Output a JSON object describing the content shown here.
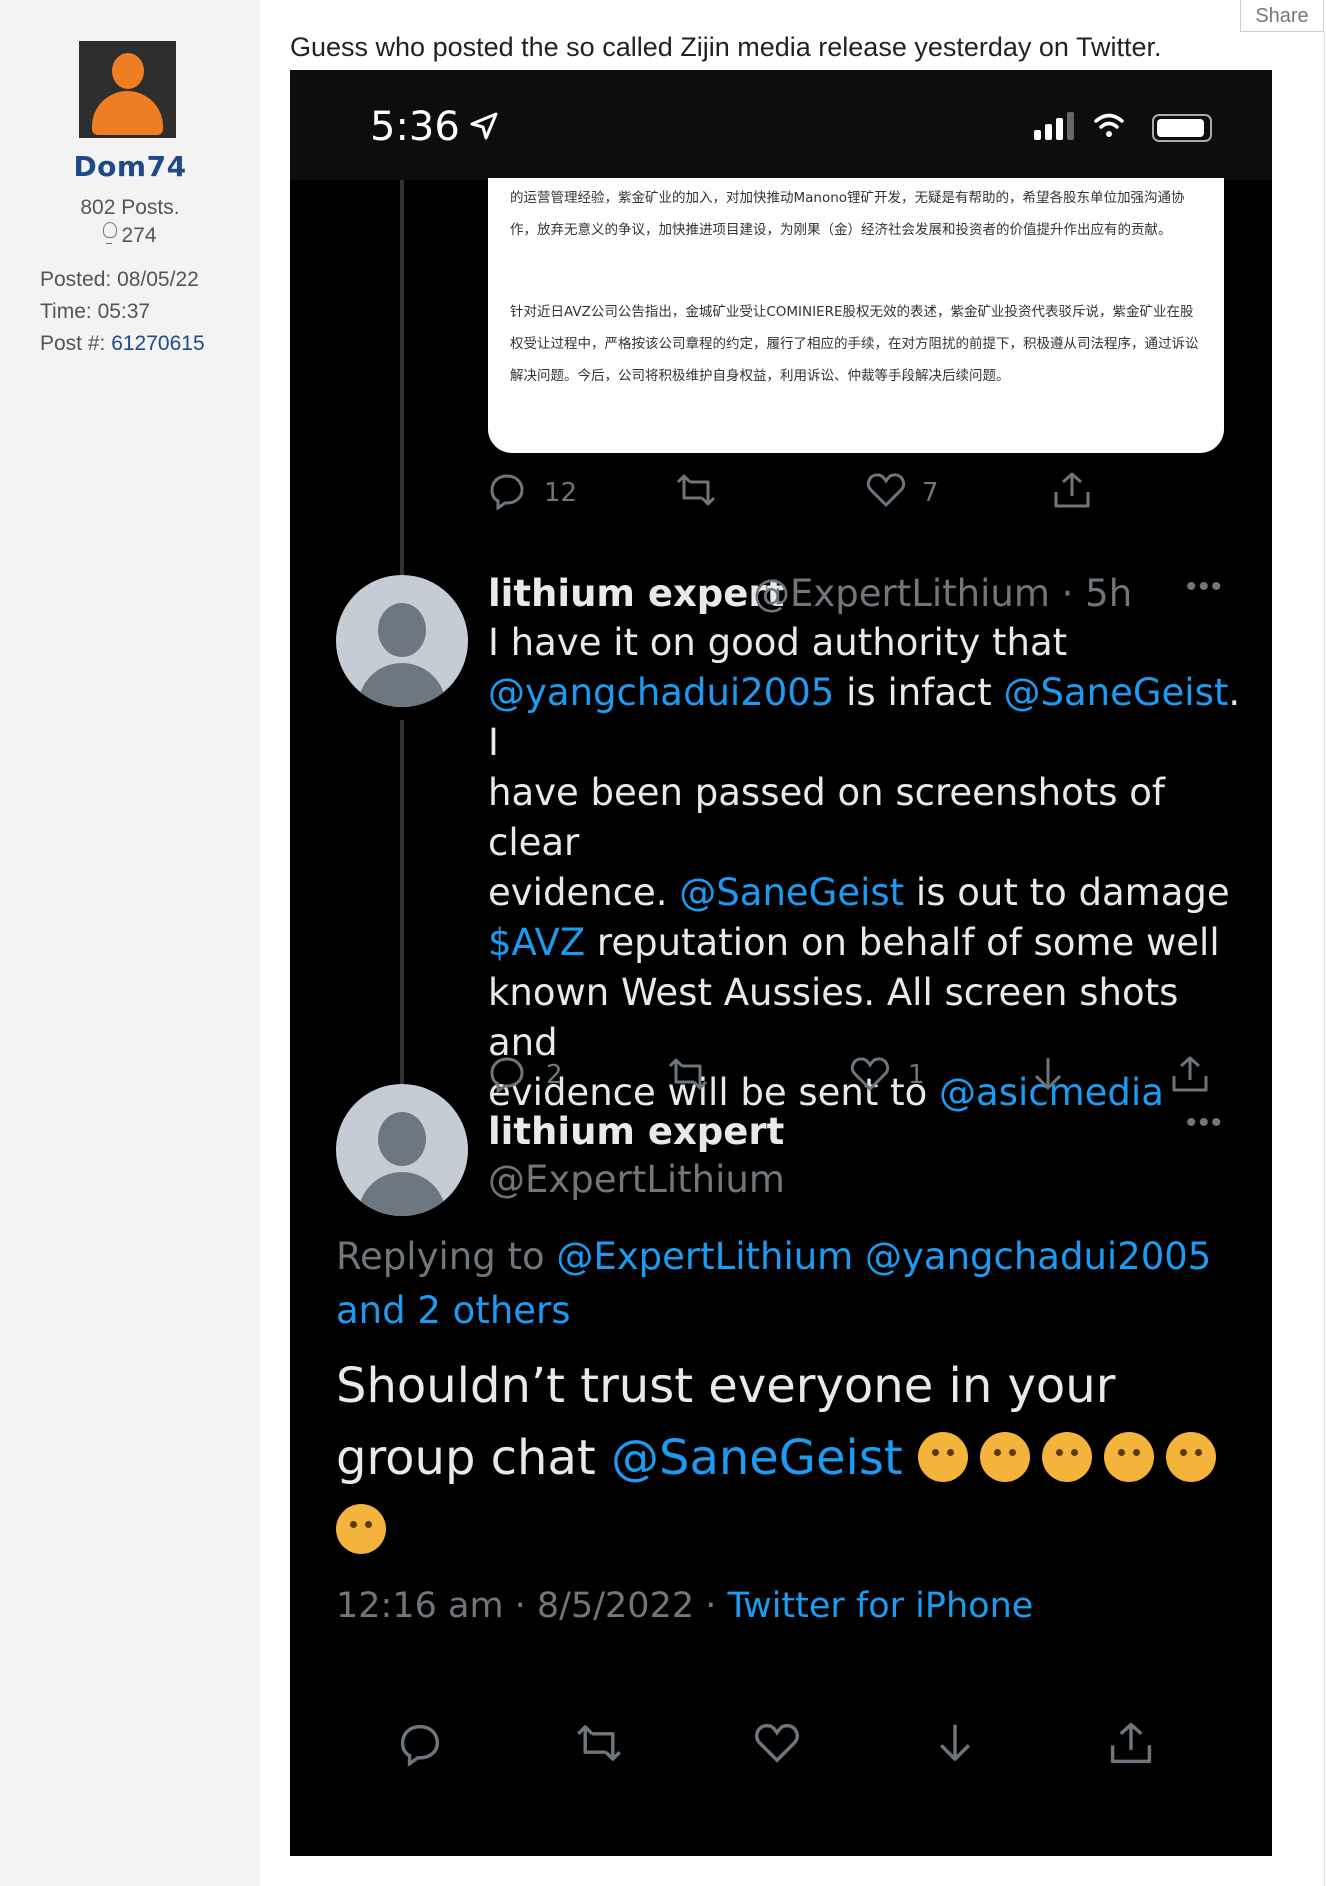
{
  "share_label": "Share",
  "user": {
    "name": "Dom74",
    "posts": "802 Posts.",
    "likes": "274",
    "posted": "08/05/22",
    "time": "05:37",
    "post_num": "61270615",
    "posted_label": "Posted: ",
    "time_label": "Time: ",
    "postnum_label": "Post #: "
  },
  "post": {
    "text": "Guess who posted the so called Zijin media release yesterday on Twitter."
  },
  "phone": {
    "time": "5:36"
  },
  "card": {
    "para1": "的运营管理经验，紫金矿业的加入，对加快推动Manono锂矿开发，无疑是有帮助的，希望各股东单位加强沟通协作，放弃无意义的争议，加快推进项目建设，为刚果（金）经济社会发展和投资者的价值提升作出应有的贡献。",
    "para2": "针对近日AVZ公司公告指出，金城矿业受让COMINIERE股权无效的表述，紫金矿业投资代表驳斥说，紫金矿业在股权受让过程中，严格按该公司章程的约定，履行了相应的手续，在对方阻扰的前提下，积极遵从司法程序，通过诉讼解决问题。今后，公司将积极维护自身权益，利用诉讼、仲裁等手段解决后续问题。"
  },
  "tweet0": {
    "replies": "12",
    "likes": "7"
  },
  "tweet1": {
    "name": "lithium expert",
    "meta": "@ExpertLithium · 5h",
    "line1": "I have it on good authority that",
    "l2_m1": "@yangchadui2005",
    "l2_t1": " is infact ",
    "l2_m2": "@SaneGeist",
    "l2_t2": ". I",
    "line3": "have been passed on screenshots of clear",
    "l4_t1": "evidence. ",
    "l4_m1": "@SaneGeist",
    "l4_t2": " is out to damage",
    "l5_m1": "$AVZ",
    "l5_t1": " reputation on behalf of some well",
    "line6": "known West Aussies. All screen shots and",
    "l7_t1": "evidence will be sent to ",
    "l7_m1": "@asicmedia",
    "replies": "2",
    "likes": "1"
  },
  "tweet2": {
    "name": "lithium expert",
    "handle": "@ExpertLithium",
    "replying_label": "Replying to ",
    "replying_m1": "@ExpertLithium",
    "replying_m2": "@yangchadui2005",
    "replying_more": "and 2 others",
    "line1": "Shouldn’t trust everyone in your",
    "line2_t1": "group chat ",
    "line2_m1": "@SaneGeist",
    "timestamp": "12:16 am · 8/5/2022 · ",
    "source": "Twitter for iPhone"
  },
  "colors": {
    "link_blue": "#1d9bf0",
    "username_blue": "#1e4a86",
    "avatar_orange": "#f07d22"
  }
}
